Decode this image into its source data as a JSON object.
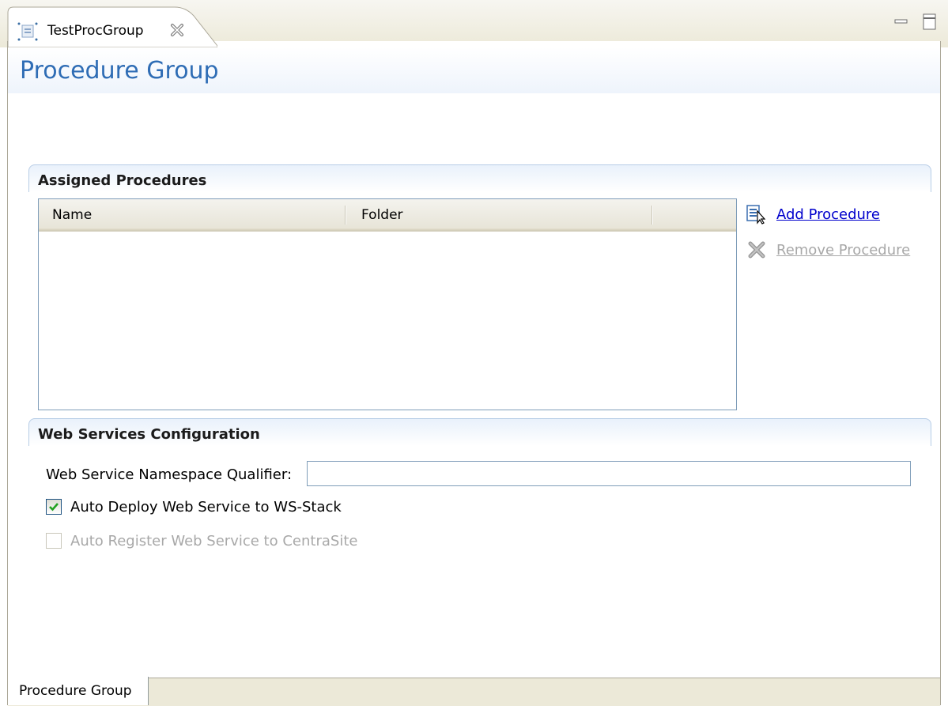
{
  "editor_tab": {
    "title": "TestProcGroup"
  },
  "form": {
    "title": "Procedure Group"
  },
  "assigned_section": {
    "title": "Assigned Procedures",
    "columns": [
      "Name",
      "Folder"
    ],
    "rows": [],
    "actions": {
      "add_label": "Add Procedure",
      "remove_label": "Remove Procedure"
    }
  },
  "ws_section": {
    "title": "Web Services Configuration",
    "namespace_label": "Web Service Namespace Qualifier:",
    "namespace_value": "",
    "auto_deploy_label": "Auto Deploy Web Service to WS-Stack",
    "auto_deploy_checked": true,
    "auto_register_label": "Auto Register Web Service to CentraSite",
    "auto_register_checked": false,
    "auto_register_enabled": false
  },
  "page_tabs": [
    "Procedure Group"
  ],
  "colors": {
    "title_blue": "#2f6db5",
    "link_blue": "#0000cc",
    "disabled_gray": "#a8a8a8",
    "check_green": "#21a121"
  }
}
